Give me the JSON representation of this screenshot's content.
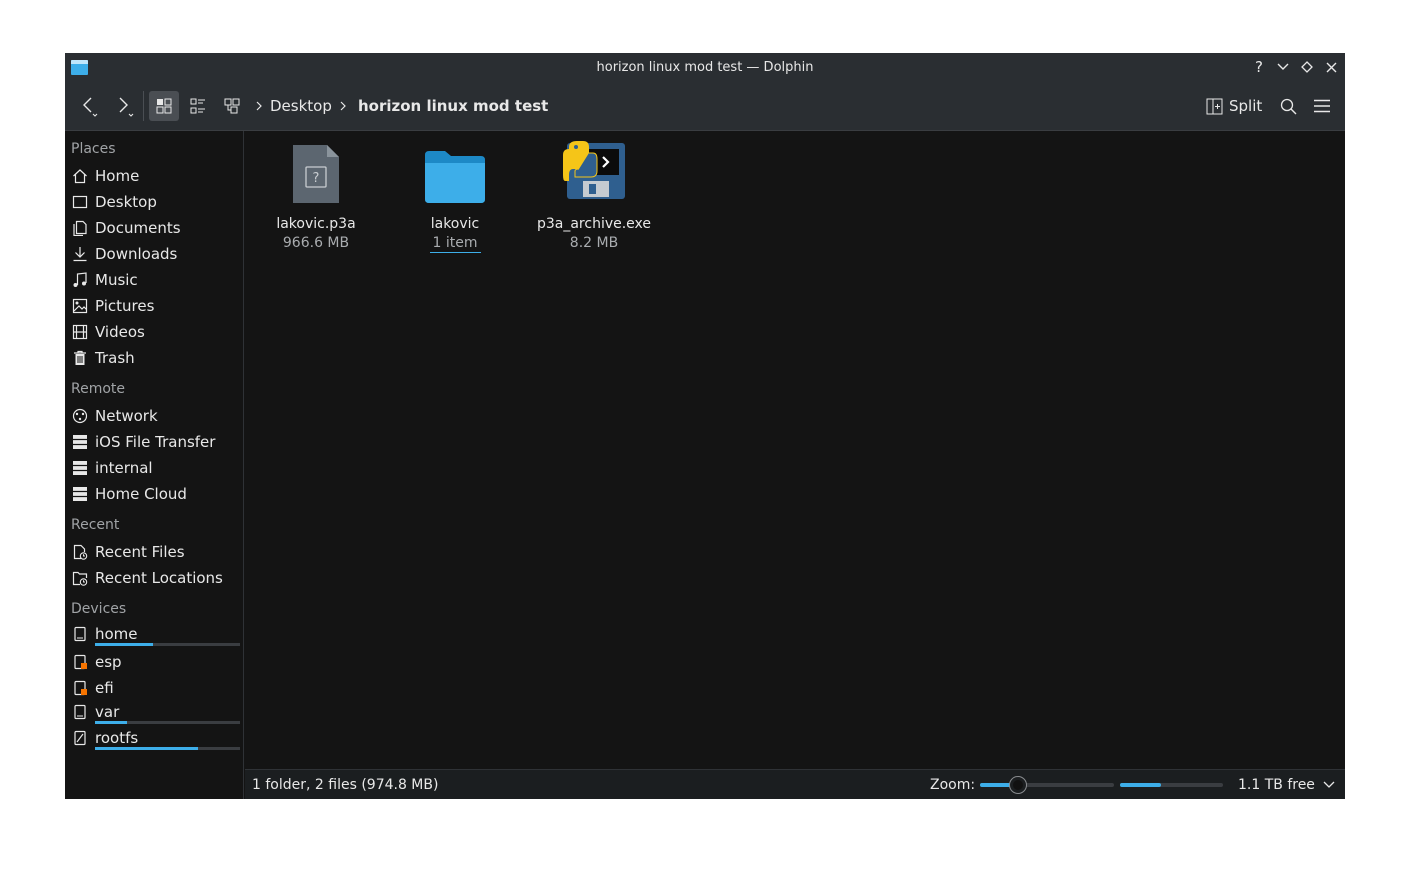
{
  "window": {
    "title": "horizon linux mod test — Dolphin"
  },
  "titlebar_buttons": {
    "help": "?"
  },
  "toolbar": {
    "breadcrumb": [
      "Desktop",
      "horizon linux mod test"
    ],
    "split_label": "Split"
  },
  "sidebar": {
    "places_heading": "Places",
    "places": [
      {
        "label": "Home",
        "icon": "home-icon"
      },
      {
        "label": "Desktop",
        "icon": "desktop-icon"
      },
      {
        "label": "Documents",
        "icon": "documents-icon"
      },
      {
        "label": "Downloads",
        "icon": "downloads-icon"
      },
      {
        "label": "Music",
        "icon": "music-icon"
      },
      {
        "label": "Pictures",
        "icon": "pictures-icon"
      },
      {
        "label": "Videos",
        "icon": "videos-icon"
      },
      {
        "label": "Trash",
        "icon": "trash-icon"
      }
    ],
    "remote_heading": "Remote",
    "remote": [
      {
        "label": "Network",
        "icon": "network-icon"
      },
      {
        "label": "iOS File Transfer",
        "icon": "remote-folder-icon"
      },
      {
        "label": "internal",
        "icon": "remote-folder-icon"
      },
      {
        "label": "Home Cloud",
        "icon": "remote-folder-icon"
      }
    ],
    "recent_heading": "Recent",
    "recent": [
      {
        "label": "Recent Files",
        "icon": "recent-files-icon"
      },
      {
        "label": "Recent Locations",
        "icon": "recent-locations-icon"
      }
    ],
    "devices_heading": "Devices",
    "devices": [
      {
        "label": "home",
        "icon": "drive-icon",
        "usage": 0.4
      },
      {
        "label": "esp",
        "icon": "drive-locked-icon"
      },
      {
        "label": "efi",
        "icon": "drive-locked-icon"
      },
      {
        "label": "var",
        "icon": "drive-icon",
        "usage": 0.22
      },
      {
        "label": "rootfs",
        "icon": "drive-readonly-icon",
        "usage": 0.71
      }
    ]
  },
  "files": [
    {
      "name": "lakovic.p3a",
      "meta": "966.6 MB",
      "icon": "unknown-file-icon"
    },
    {
      "name": "lakovic",
      "meta": "1 item",
      "icon": "folder-icon"
    },
    {
      "name": "p3a_archive.exe",
      "meta": "8.2 MB",
      "icon": "python-executable-icon"
    }
  ],
  "statusbar": {
    "summary": "1 folder, 2 files (974.8 MB)",
    "zoom_label": "Zoom:",
    "zoom_level": 0.28,
    "space_used": 0.4,
    "free_space": "1.1 TB free"
  },
  "colors": {
    "accent": "#3daee9",
    "window_bg": "#141414",
    "titlebar_bg": "#2a2e32"
  }
}
